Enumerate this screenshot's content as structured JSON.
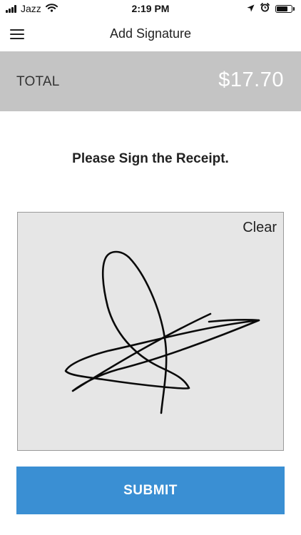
{
  "status_bar": {
    "carrier": "Jazz",
    "time": "2:19 PM",
    "battery_level": 0.85,
    "icons": [
      "signal-bars-icon",
      "wifi-icon",
      "location-arrow-icon",
      "alarm-clock-icon",
      "battery-icon"
    ]
  },
  "nav": {
    "title": "Add Signature",
    "menu_icon": "hamburger-menu-icon"
  },
  "total": {
    "label": "TOTAL",
    "amount": "$17.70"
  },
  "instruction": "Please Sign the Receipt.",
  "signature_pad": {
    "clear_label": "Clear"
  },
  "submit_label": "SUBMIT",
  "colors": {
    "total_band": "#c4c4c4",
    "pad_background": "#e6e6e6",
    "submit_blue": "#3a8fd3"
  }
}
